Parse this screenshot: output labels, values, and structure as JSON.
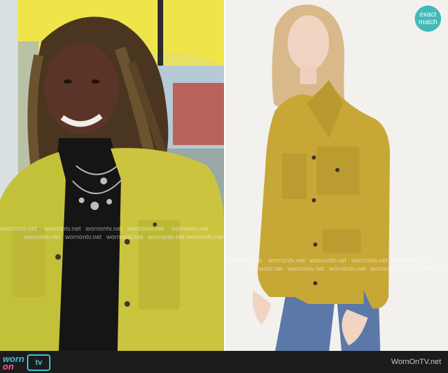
{
  "badge": {
    "line1": "exact",
    "line2": "match",
    "color": "#43b9ba"
  },
  "watermark": {
    "text": "wornontv.net"
  },
  "footer": {
    "logo": {
      "worn": "worn",
      "on": "on",
      "tv": "tv"
    },
    "credit": "WornOnTV.net",
    "background": "#1c1c1c"
  },
  "photos": {
    "left": {
      "icon": "tv-still-photo"
    },
    "right": {
      "icon": "product-photo"
    }
  },
  "colors": {
    "jacket": "#c9b12f",
    "accent": "#3ec3d4",
    "pink": "#ff5aa5"
  }
}
